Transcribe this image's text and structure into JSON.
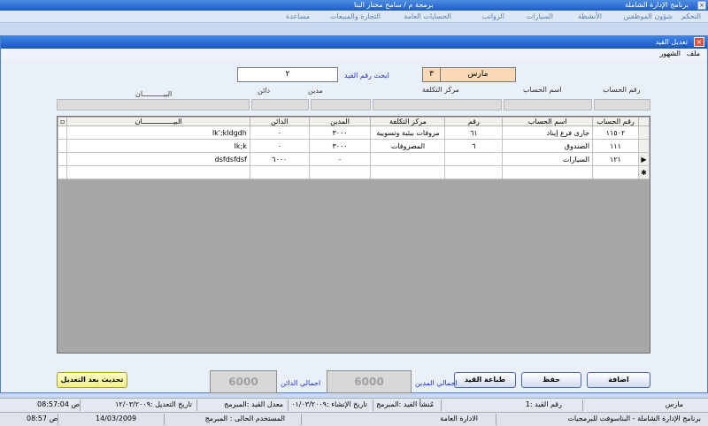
{
  "app_title": "برنامج الإدارة الشاملة",
  "app_subtitle": "برمجة م / سامح مختار البنا",
  "menubar": [
    "التحكم",
    "شؤون الموظفين",
    "الأنشطة",
    "السيارات",
    "الرواتب",
    "الحسابات العامة",
    "التجارة والمبيعات",
    "مساعدة"
  ],
  "inner_window": {
    "title": "تعديل القيد",
    "menu": [
      "ملف",
      "الشهور"
    ]
  },
  "month_label": "مارس",
  "month_number": "٣",
  "search_label": "ابحث رقم القيد",
  "search_value": "٢",
  "header_labels": {
    "account_no": "رقم الحساب",
    "account_name": "اسم الحساب",
    "cost_center": "مركز التكلفة",
    "debit": "مدين",
    "credit": "دائن",
    "description": "البيــــــــــان"
  },
  "grid": {
    "columns": [
      "رقم الحساب",
      "اسم الحساب",
      "رقم",
      "مركز التكلفة",
      "المدين",
      "الدائن",
      "البيـــــــــــــــان"
    ],
    "rows": [
      {
        "account_no": "١١٥٠٢",
        "account_name": "جارى فرع إيناد",
        "num": "٦١",
        "cost_center": "مروفات بيئية وتسويية",
        "debit": "٣٠٠٠",
        "credit": "٠",
        "description": "lk';kldgdh"
      },
      {
        "account_no": "١١١",
        "account_name": "الصندوق",
        "num": "٦",
        "cost_center": "المصروفات",
        "debit": "٣٠٠٠",
        "credit": "٠",
        "description": "lk;k"
      },
      {
        "account_no": "١٢١",
        "account_name": "السيارات",
        "num": "",
        "cost_center": "",
        "debit": "٠",
        "credit": "٦٠٠٠",
        "description": "dsfdsfdsf"
      }
    ]
  },
  "buttons": {
    "add": "اضافة",
    "save": "حفظ",
    "print": "طباعة القيد",
    "update": "تحديث بعد التعديل"
  },
  "totals": {
    "debit_label": "اجمالي المدين",
    "debit_value": "6000",
    "credit_label": "اجمالي الدائن",
    "credit_value": "6000"
  },
  "status_bar_1": {
    "month": "مارس",
    "entry_no": "رقم القيد :1",
    "created_by": "مُنشأ القيد :المبرمج",
    "created_date": "تاريخ الإنشاء :٠١/٠٣/٢٠٠٩",
    "modified_by": "معدل القيد :المبرمج",
    "modified_date": "تاريخ التعديل :١٢/٠٣/٢٠٠٩",
    "time": "ص 08:57:04"
  },
  "status_bar_2": {
    "app": "برنامج الإدارة الشاملة - البناسوفت للبرمجيات",
    "dept": "الادارة العامة",
    "user": "المستخدم الحالى : المبرمج",
    "date": "14/03/2009",
    "time": "ص 08:57"
  }
}
